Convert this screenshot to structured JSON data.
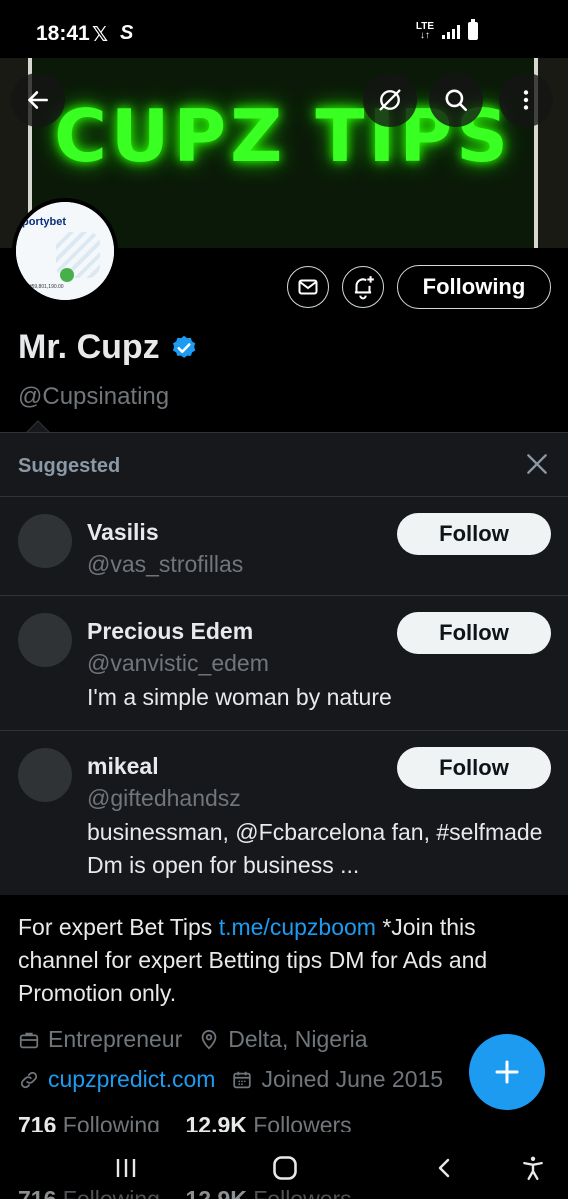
{
  "status_bar": {
    "time": "18:41",
    "app_icon_x": "𝕏",
    "app_icon_s": "S",
    "network": "LTE",
    "network_arrows": "↓↑"
  },
  "banner": {
    "text": "CUPZ TIPS",
    "glow_color": "#3aff22"
  },
  "profile": {
    "avatar_brand": "portybet",
    "avatar_caption": "₦59,801,190.00",
    "following_label": "Following",
    "name": "Mr. Cupz",
    "handle": "@Cupsinating",
    "verified": true
  },
  "suggested": {
    "title": "Suggested",
    "items": [
      {
        "name": "Vasilis",
        "handle": "@vas_strofillas",
        "bio": "",
        "button": "Follow"
      },
      {
        "name": "Precious Edem",
        "handle": "@vanvistic_edem",
        "bio": "I'm a simple woman by nature",
        "button": "Follow"
      },
      {
        "name": "mikeal",
        "handle": "@giftedhandsz",
        "bio": "businessman, @Fcbarcelona  fan, #selfmade Dm is open for business ...",
        "button": "Follow"
      }
    ]
  },
  "bio": {
    "before_link": "For expert Bet Tips  ",
    "link": "t.me/cupzboom",
    "after_link": "  *Join this channel for expert Betting tips DM for Ads and Promotion only."
  },
  "meta": {
    "profession": "Entrepreneur",
    "location": "Delta, Nigeria",
    "website": "cupzpredict.com",
    "joined": "Joined June 2015"
  },
  "counts": {
    "following_count": "716",
    "following_label": "Following",
    "followers_count": "12.9K",
    "followers_label": "Followers"
  },
  "colors": {
    "accent": "#1d9bf0",
    "background": "#000000",
    "panel": "#16181c"
  }
}
